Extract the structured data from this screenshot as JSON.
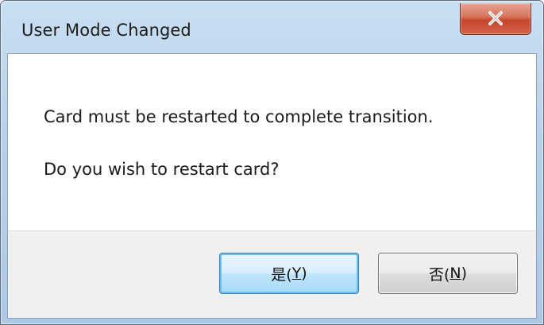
{
  "window": {
    "title": "User Mode Changed",
    "close_icon": "close-x-icon"
  },
  "message": {
    "line1": "Card must be restarted to complete transition.",
    "line2": "Do you wish to restart card?"
  },
  "buttons": {
    "yes_label_prefix": "是(",
    "yes_label_key": "Y",
    "yes_label_suffix": ")",
    "no_label_prefix": "否(",
    "no_label_key": "N",
    "no_label_suffix": ")"
  },
  "colors": {
    "close_button": "#d0563b",
    "default_button_border": "#3c7fb1"
  }
}
